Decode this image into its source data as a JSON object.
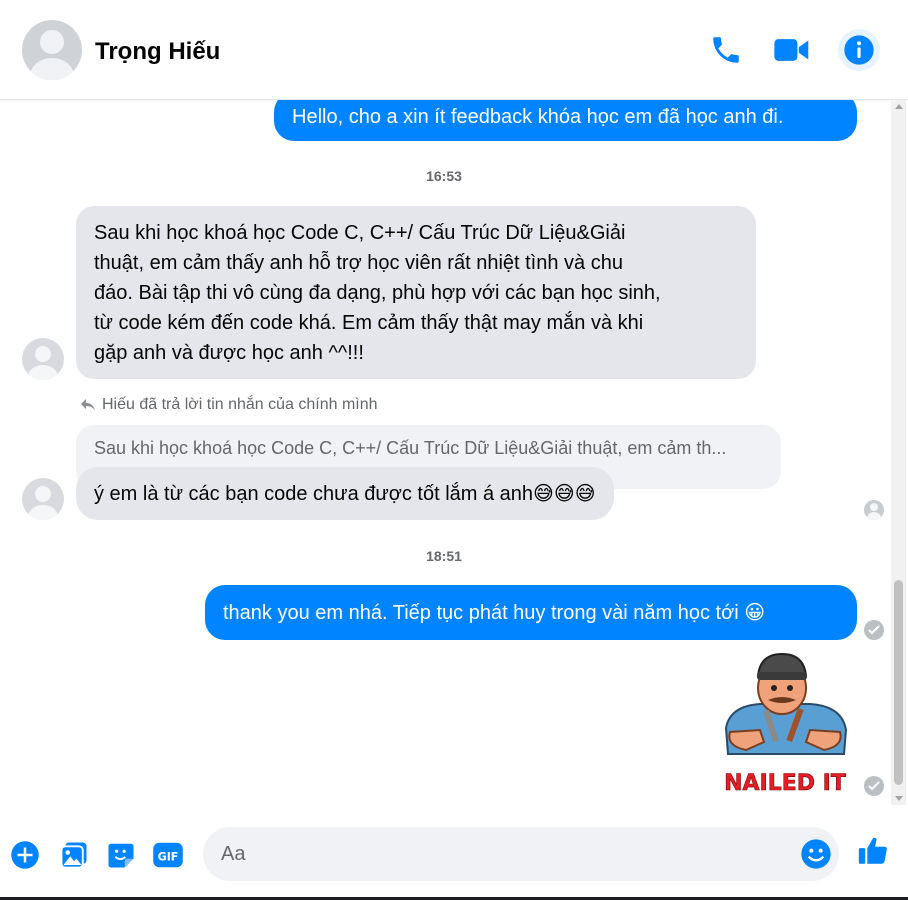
{
  "header": {
    "contact_name": "Trọng Hiếu",
    "icons": [
      "phone-icon",
      "video-call-icon",
      "info-icon"
    ]
  },
  "messages": {
    "m1_text": "Hello, cho a xin ít feedback khóa học em đã học anh đi.",
    "time1": "16:53",
    "m2_lines": [
      "Sau khi học khoá học Code C, C++/ Cấu Trúc Dữ Liệu&Giải",
      "thuật, em cảm thấy anh hỗ trợ học viên rất nhiệt tình  và chu",
      "đáo. Bài tập thi vô cùng đa dạng, phù hợp với các bạn học sinh,",
      "từ  code kém đến code khá. Em cảm thấy thật may mắn và khi",
      "gặp anh và được học anh ^^!!!"
    ],
    "reply_note": "Hiếu đã trả lời tin nhắn của chính mình",
    "quoted_preview": "Sau khi học khoá học Code C, C++/ Cấu Trúc Dữ Liệu&Giải thuật, em cảm th...",
    "m3_text": "ý em là từ các bạn code chưa được tốt lắm á anh😅😅😅",
    "time2": "18:51",
    "m4_text": "thank you em nhá. Tiếp tục phát huy trong vài năm học tới 😀",
    "sticker_caption": "NAILED IT"
  },
  "composer": {
    "placeholder": "Aa",
    "icons": [
      "add-icon",
      "photo-icon",
      "sticker-icon",
      "gif-icon",
      "emoji-icon",
      "like-icon"
    ],
    "gif_label": "GIF"
  },
  "colors": {
    "accent": "#0084ff",
    "incoming_bubble": "#e4e6eb",
    "secondary_text": "#65676b"
  }
}
